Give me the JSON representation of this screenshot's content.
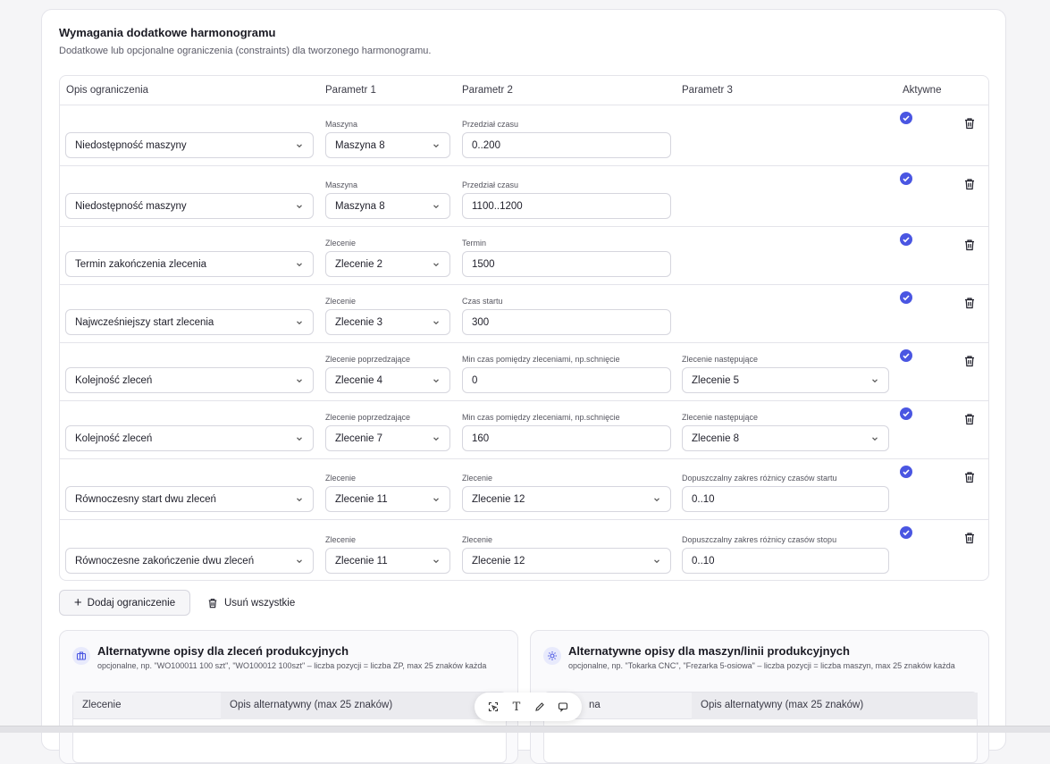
{
  "section": {
    "title": "Wymagania dodatkowe harmonogramu",
    "subtitle": "Dodatkowe lub opcjonalne ograniczenia (constraints) dla tworzonego harmonogramu."
  },
  "table": {
    "headers": [
      "Opis ograniczenia",
      "Parametr 1",
      "Parametr 2",
      "Parametr 3",
      "Aktywne"
    ],
    "rows": [
      {
        "desc": "Niedostępność maszyny",
        "p1_label": "Maszyna",
        "p1_value": "Maszyna 8",
        "p2_label": "Przedział czasu",
        "p2_value": "0..200",
        "p3_label": "",
        "p3_value": "",
        "active": true
      },
      {
        "desc": "Niedostępność maszyny",
        "p1_label": "Maszyna",
        "p1_value": "Maszyna 8",
        "p2_label": "Przedział czasu",
        "p2_value": "1100..1200",
        "p3_label": "",
        "p3_value": "",
        "active": true
      },
      {
        "desc": "Termin zakończenia zlecenia",
        "p1_label": "Zlecenie",
        "p1_value": "Zlecenie 2",
        "p2_label": "Termin",
        "p2_value": "1500",
        "p3_label": "",
        "p3_value": "",
        "active": true
      },
      {
        "desc": "Najwcześniejszy start zlecenia",
        "p1_label": "Zlecenie",
        "p1_value": "Zlecenie 3",
        "p2_label": "Czas startu",
        "p2_value": "300",
        "p3_label": "",
        "p3_value": "",
        "active": true
      },
      {
        "desc": "Kolejność zleceń",
        "p1_label": "Zlecenie poprzedzające",
        "p1_value": "Zlecenie 4",
        "p2_label": "Min czas pomiędzy zleceniami, np.schnięcie",
        "p2_value": "0",
        "p3_label": "Zlecenie następujące",
        "p3_value": "Zlecenie 5",
        "active": true
      },
      {
        "desc": "Kolejność zleceń",
        "p1_label": "Zlecenie poprzedzające",
        "p1_value": "Zlecenie 7",
        "p2_label": "Min czas pomiędzy zleceniami, np.schnięcie",
        "p2_value": "160",
        "p3_label": "Zlecenie następujące",
        "p3_value": "Zlecenie 8",
        "active": true
      },
      {
        "desc": "Równoczesny start dwu zleceń",
        "p1_label": "Zlecenie",
        "p1_value": "Zlecenie 11",
        "p2_label": "Zlecenie",
        "p2_value": "Zlecenie 12",
        "p3_label": "Dopuszczalny zakres różnicy czasów startu",
        "p3_value": "0..10",
        "active": true
      },
      {
        "desc": "Równoczesne zakończenie dwu zleceń",
        "p1_label": "Zlecenie",
        "p1_value": "Zlecenie 11",
        "p2_label": "Zlecenie",
        "p2_value": "Zlecenie 12",
        "p3_label": "Dopuszczalny zakres różnicy czasów stopu",
        "p3_value": "0..10",
        "active": true
      }
    ]
  },
  "actions": {
    "add_label": "Dodaj ograniczenie",
    "delete_all_label": "Usuń wszystkie"
  },
  "orders_card": {
    "title": "Alternatywne opisy dla zleceń produkcyjnych",
    "subtitle": "opcjonalne, np. \"WO100011 100 szt\", \"WO100012 100szt\" – liczba pozycji = liczba ZP, max 25 znaków każda",
    "col1": "Zlecenie",
    "col2": "Opis alternatywny (max 25 znaków)"
  },
  "machines_card": {
    "title": "Alternatywne opisy dla maszyn/linii produkcyjnych",
    "subtitle": "opcjonalne, np. \"Tokarka CNC\", \"Frezarka 5-osiowa\" – liczba pozycji = liczba maszyn, max 25 znaków każda",
    "col1": "na",
    "col2": "Opis alternatywny (max 25 znaków)"
  },
  "toolbar": {
    "text_tool": "T"
  },
  "colors": {
    "accent": "#4a56e2",
    "border": "#e4e4ea"
  }
}
